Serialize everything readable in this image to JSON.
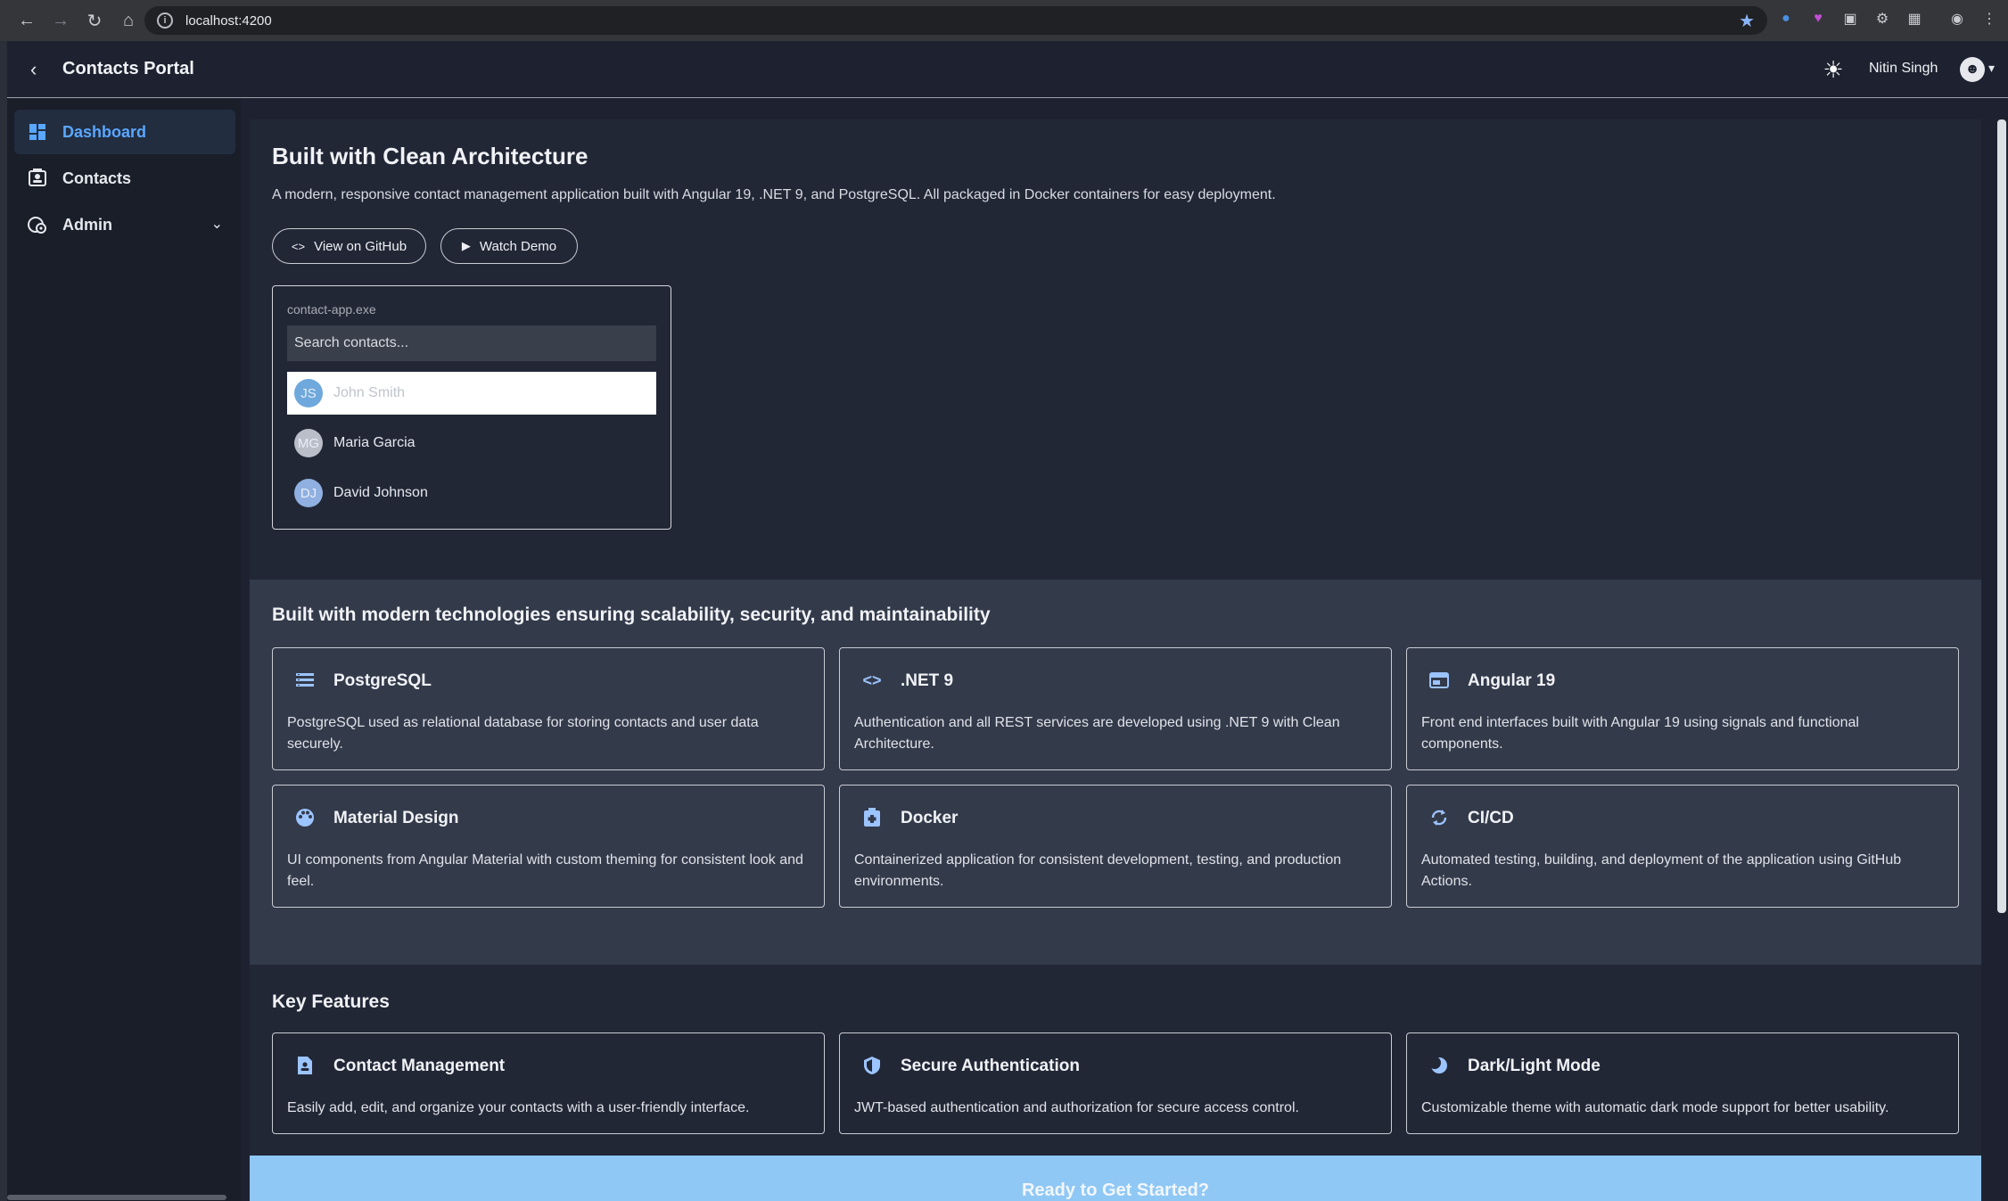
{
  "browser": {
    "url": "localhost:4200"
  },
  "header": {
    "title": "Contacts Portal",
    "user_name": "Nitin Singh"
  },
  "sidebar": {
    "items": [
      {
        "label": "Dashboard",
        "icon": "dashboard-icon",
        "active": true
      },
      {
        "label": "Contacts",
        "icon": "contacts-icon",
        "active": false
      },
      {
        "label": "Admin",
        "icon": "admin-icon",
        "active": false
      }
    ]
  },
  "hero": {
    "title": "Built with Clean Architecture",
    "description": "A modern, responsive contact management application built with Angular 19, .NET 9, and PostgreSQL. All packaged in Docker containers for easy deployment.",
    "github_label": "View on GitHub",
    "demo_label": "Watch Demo",
    "demo_window": {
      "caption": "contact-app.exe",
      "search_placeholder": "Search contacts...",
      "contacts": [
        {
          "initials": "JS",
          "name": "John Smith",
          "color": "#6fa8dc"
        },
        {
          "initials": "MG",
          "name": "Maria Garcia",
          "color": "#b9bec9"
        },
        {
          "initials": "DJ",
          "name": "David Johnson",
          "color": "#8fb0e0"
        }
      ]
    }
  },
  "tech": {
    "title": "Built with modern technologies ensuring scalability, security, and maintainability",
    "cards": [
      {
        "title": "PostgreSQL",
        "icon": "database-icon",
        "desc": "PostgreSQL used as relational database for storing contacts and user data securely."
      },
      {
        "title": ".NET 9",
        "icon": "code-icon",
        "desc": "Authentication and all REST services are developed using .NET 9 with Clean Architecture."
      },
      {
        "title": "Angular 19",
        "icon": "web-icon",
        "desc": "Front end interfaces built with Angular 19 using signals and functional components."
      },
      {
        "title": "Material Design",
        "icon": "palette-icon",
        "desc": "UI components from Angular Material with custom theming for consistent look and feel."
      },
      {
        "title": "Docker",
        "icon": "docker-icon",
        "desc": "Containerized application for consistent development, testing, and production environments."
      },
      {
        "title": "CI/CD",
        "icon": "sync-icon",
        "desc": "Automated testing, building, and deployment of the application using GitHub Actions."
      }
    ]
  },
  "features": {
    "title": "Key Features",
    "cards": [
      {
        "title": "Contact Management",
        "icon": "contact-page-icon",
        "desc": "Easily add, edit, and organize your contacts with a user-friendly interface."
      },
      {
        "title": "Secure Authentication",
        "icon": "shield-icon",
        "desc": "JWT-based authentication and authorization for secure access control."
      },
      {
        "title": "Dark/Light Mode",
        "icon": "moon-icon",
        "desc": "Customizable theme with automatic dark mode support for better usability."
      }
    ]
  },
  "cta": {
    "title": "Ready to Get Started?"
  }
}
